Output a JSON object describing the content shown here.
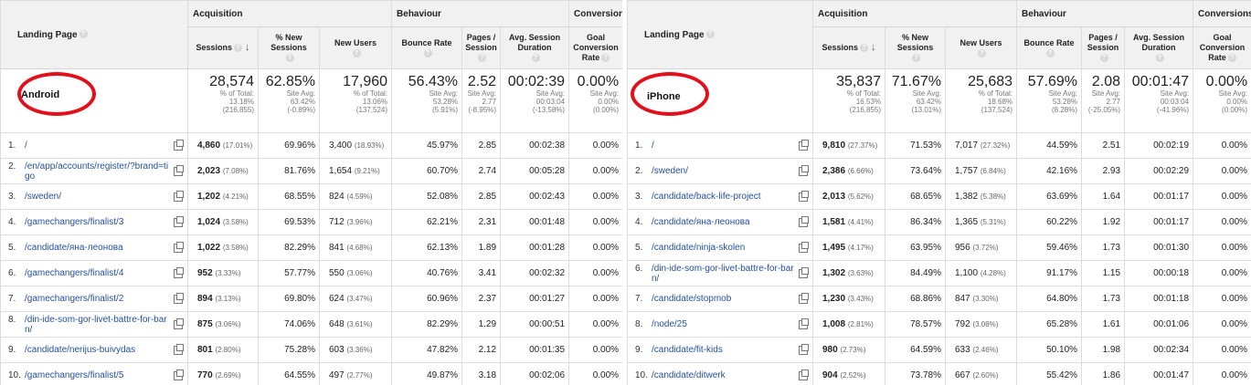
{
  "headers": {
    "landing_page": "Landing Page",
    "acquisition": "Acquisition",
    "behaviour": "Behaviour",
    "conversions": "Conversions",
    "sessions": "Sessions",
    "pct_new_sessions": [
      "% New",
      "Sessions"
    ],
    "new_users": "New Users",
    "bounce_rate": "Bounce Rate",
    "pages_session": [
      "Pages /",
      "Session"
    ],
    "avg_session": [
      "Avg. Session",
      "Duration"
    ],
    "goal_conv": [
      "Goal",
      "Conversion",
      "Rate"
    ]
  },
  "help_icon": "question-circle-icon",
  "sort_icon": "arrow-down-icon",
  "accent_color": "#e3101c",
  "link_color": "#24509e",
  "panels": [
    {
      "segment": "Android",
      "totals": {
        "sessions": "28,574",
        "sessions_sub": [
          "% of Total:",
          "13.18%",
          "(216,855)"
        ],
        "pct_new": "62.85%",
        "pct_new_sub": [
          "Site Avg:",
          "63.42%",
          "(-0.89%)"
        ],
        "new_users": "17,960",
        "new_users_sub": [
          "% of Total:",
          "13.06%",
          "(137,524)"
        ],
        "bounce": "56.43%",
        "bounce_sub": [
          "Site Avg:",
          "53.28%",
          "(5.91%)"
        ],
        "pages": "2.52",
        "pages_sub": [
          "Site Avg:",
          "2.77",
          "(-8.95%)"
        ],
        "avg": "00:02:39",
        "avg_sub": [
          "Site Avg:",
          "00:03:04",
          "(-13.58%)"
        ],
        "goal": "0.00%",
        "goal_sub": [
          "Site Avg:",
          "0.00%",
          "(0.00%)"
        ]
      },
      "rows": [
        {
          "n": "1.",
          "page": "/",
          "sessions": "4,860",
          "spct": "(17.01%)",
          "new_pct": "69.96%",
          "users": "3,400",
          "upct": "(18.93%)",
          "bounce": "45.97%",
          "pages": "2.85",
          "dur": "00:02:38",
          "goal": "0.00%"
        },
        {
          "n": "2.",
          "page": "/en/app/accounts/register/?brand=tigo",
          "sessions": "2,023",
          "spct": "(7.08%)",
          "new_pct": "81.76%",
          "users": "1,654",
          "upct": "(9.21%)",
          "bounce": "60.70%",
          "pages": "2.74",
          "dur": "00:05:28",
          "goal": "0.00%"
        },
        {
          "n": "3.",
          "page": "/sweden/",
          "sessions": "1,202",
          "spct": "(4.21%)",
          "new_pct": "68.55%",
          "users": "824",
          "upct": "(4.59%)",
          "bounce": "52.08%",
          "pages": "2.85",
          "dur": "00:02:43",
          "goal": "0.00%"
        },
        {
          "n": "4.",
          "page": "/gamechangers/finalist/3",
          "sessions": "1,024",
          "spct": "(3.58%)",
          "new_pct": "69.53%",
          "users": "712",
          "upct": "(3.96%)",
          "bounce": "62.21%",
          "pages": "2.31",
          "dur": "00:01:48",
          "goal": "0.00%"
        },
        {
          "n": "5.",
          "page": "/candidate/яна-леонова",
          "sessions": "1,022",
          "spct": "(3.58%)",
          "new_pct": "82.29%",
          "users": "841",
          "upct": "(4.68%)",
          "bounce": "62.13%",
          "pages": "1.89",
          "dur": "00:01:28",
          "goal": "0.00%"
        },
        {
          "n": "6.",
          "page": "/gamechangers/finalist/4",
          "sessions": "952",
          "spct": "(3.33%)",
          "new_pct": "57.77%",
          "users": "550",
          "upct": "(3.06%)",
          "bounce": "40.76%",
          "pages": "3.41",
          "dur": "00:02:32",
          "goal": "0.00%"
        },
        {
          "n": "7.",
          "page": "/gamechangers/finalist/2",
          "sessions": "894",
          "spct": "(3.13%)",
          "new_pct": "69.80%",
          "users": "624",
          "upct": "(3.47%)",
          "bounce": "60.96%",
          "pages": "2.37",
          "dur": "00:01:27",
          "goal": "0.00%"
        },
        {
          "n": "8.",
          "page": "/din-ide-som-gor-livet-battre-for-barn/",
          "sessions": "875",
          "spct": "(3.06%)",
          "new_pct": "74.06%",
          "users": "648",
          "upct": "(3.61%)",
          "bounce": "82.29%",
          "pages": "1.29",
          "dur": "00:00:51",
          "goal": "0.00%"
        },
        {
          "n": "9.",
          "page": "/candidate/nerijus-buivydas",
          "sessions": "801",
          "spct": "(2.80%)",
          "new_pct": "75.28%",
          "users": "603",
          "upct": "(3.36%)",
          "bounce": "47.82%",
          "pages": "2.12",
          "dur": "00:01:35",
          "goal": "0.00%"
        },
        {
          "n": "10.",
          "page": "/gamechangers/finalist/5",
          "sessions": "770",
          "spct": "(2.69%)",
          "new_pct": "64.55%",
          "users": "497",
          "upct": "(2.77%)",
          "bounce": "49.87%",
          "pages": "3.18",
          "dur": "00:02:06",
          "goal": "0.00%"
        }
      ]
    },
    {
      "segment": "iPhone",
      "totals": {
        "sessions": "35,837",
        "sessions_sub": [
          "% of Total:",
          "16.53%",
          "(216,855)"
        ],
        "pct_new": "71.67%",
        "pct_new_sub": [
          "Site Avg:",
          "63.42%",
          "(13.01%)"
        ],
        "new_users": "25,683",
        "new_users_sub": [
          "% of Total:",
          "18.68%",
          "(137,524)"
        ],
        "bounce": "57.69%",
        "bounce_sub": [
          "Site Avg:",
          "53.28%",
          "(8.28%)"
        ],
        "pages": "2.08",
        "pages_sub": [
          "Site Avg:",
          "2.77",
          "(-25.05%)"
        ],
        "avg": "00:01:47",
        "avg_sub": [
          "Site Avg:",
          "00:03:04",
          "(-41.96%)"
        ],
        "goal": "0.00%",
        "goal_sub": [
          "Site Avg:",
          "0.00%",
          "(0.00%)"
        ]
      },
      "rows": [
        {
          "n": "1.",
          "page": "/",
          "sessions": "9,810",
          "spct": "(27.37%)",
          "new_pct": "71.53%",
          "users": "7,017",
          "upct": "(27.32%)",
          "bounce": "44.59%",
          "pages": "2.51",
          "dur": "00:02:19",
          "goal": "0.00%"
        },
        {
          "n": "2.",
          "page": "/sweden/",
          "sessions": "2,386",
          "spct": "(6.66%)",
          "new_pct": "73.64%",
          "users": "1,757",
          "upct": "(6.84%)",
          "bounce": "42.16%",
          "pages": "2.93",
          "dur": "00:02:29",
          "goal": "0.00%"
        },
        {
          "n": "3.",
          "page": "/candidate/back-life-project",
          "sessions": "2,013",
          "spct": "(5.62%)",
          "new_pct": "68.65%",
          "users": "1,382",
          "upct": "(5.38%)",
          "bounce": "63.69%",
          "pages": "1.64",
          "dur": "00:01:17",
          "goal": "0.00%"
        },
        {
          "n": "4.",
          "page": "/candidate/яна-леонова",
          "sessions": "1,581",
          "spct": "(4.41%)",
          "new_pct": "86.34%",
          "users": "1,365",
          "upct": "(5.31%)",
          "bounce": "60.22%",
          "pages": "1.92",
          "dur": "00:01:17",
          "goal": "0.00%"
        },
        {
          "n": "5.",
          "page": "/candidate/ninja-skolen",
          "sessions": "1,495",
          "spct": "(4.17%)",
          "new_pct": "63.95%",
          "users": "956",
          "upct": "(3.72%)",
          "bounce": "59.46%",
          "pages": "1.73",
          "dur": "00:01:30",
          "goal": "0.00%"
        },
        {
          "n": "6.",
          "page": "/din-ide-som-gor-livet-battre-for-barn/",
          "sessions": "1,302",
          "spct": "(3.63%)",
          "new_pct": "84.49%",
          "users": "1,100",
          "upct": "(4.28%)",
          "bounce": "91.17%",
          "pages": "1.15",
          "dur": "00:00:18",
          "goal": "0.00%"
        },
        {
          "n": "7.",
          "page": "/candidate/stopmob",
          "sessions": "1,230",
          "spct": "(3.43%)",
          "new_pct": "68.86%",
          "users": "847",
          "upct": "(3.30%)",
          "bounce": "64.80%",
          "pages": "1.73",
          "dur": "00:01:18",
          "goal": "0.00%"
        },
        {
          "n": "8.",
          "page": "/node/25",
          "sessions": "1,008",
          "spct": "(2.81%)",
          "new_pct": "78.57%",
          "users": "792",
          "upct": "(3.08%)",
          "bounce": "65.28%",
          "pages": "1.61",
          "dur": "00:01:06",
          "goal": "0.00%"
        },
        {
          "n": "9.",
          "page": "/candidate/fit-kids",
          "sessions": "980",
          "spct": "(2.73%)",
          "new_pct": "64.59%",
          "users": "633",
          "upct": "(2.46%)",
          "bounce": "50.10%",
          "pages": "1.98",
          "dur": "00:02:34",
          "goal": "0.00%"
        },
        {
          "n": "10.",
          "page": "/candidate/ditwerk",
          "sessions": "904",
          "spct": "(2.52%)",
          "new_pct": "73.78%",
          "users": "667",
          "upct": "(2.60%)",
          "bounce": "55.42%",
          "pages": "1.86",
          "dur": "00:01:47",
          "goal": "0.00%"
        }
      ]
    }
  ]
}
